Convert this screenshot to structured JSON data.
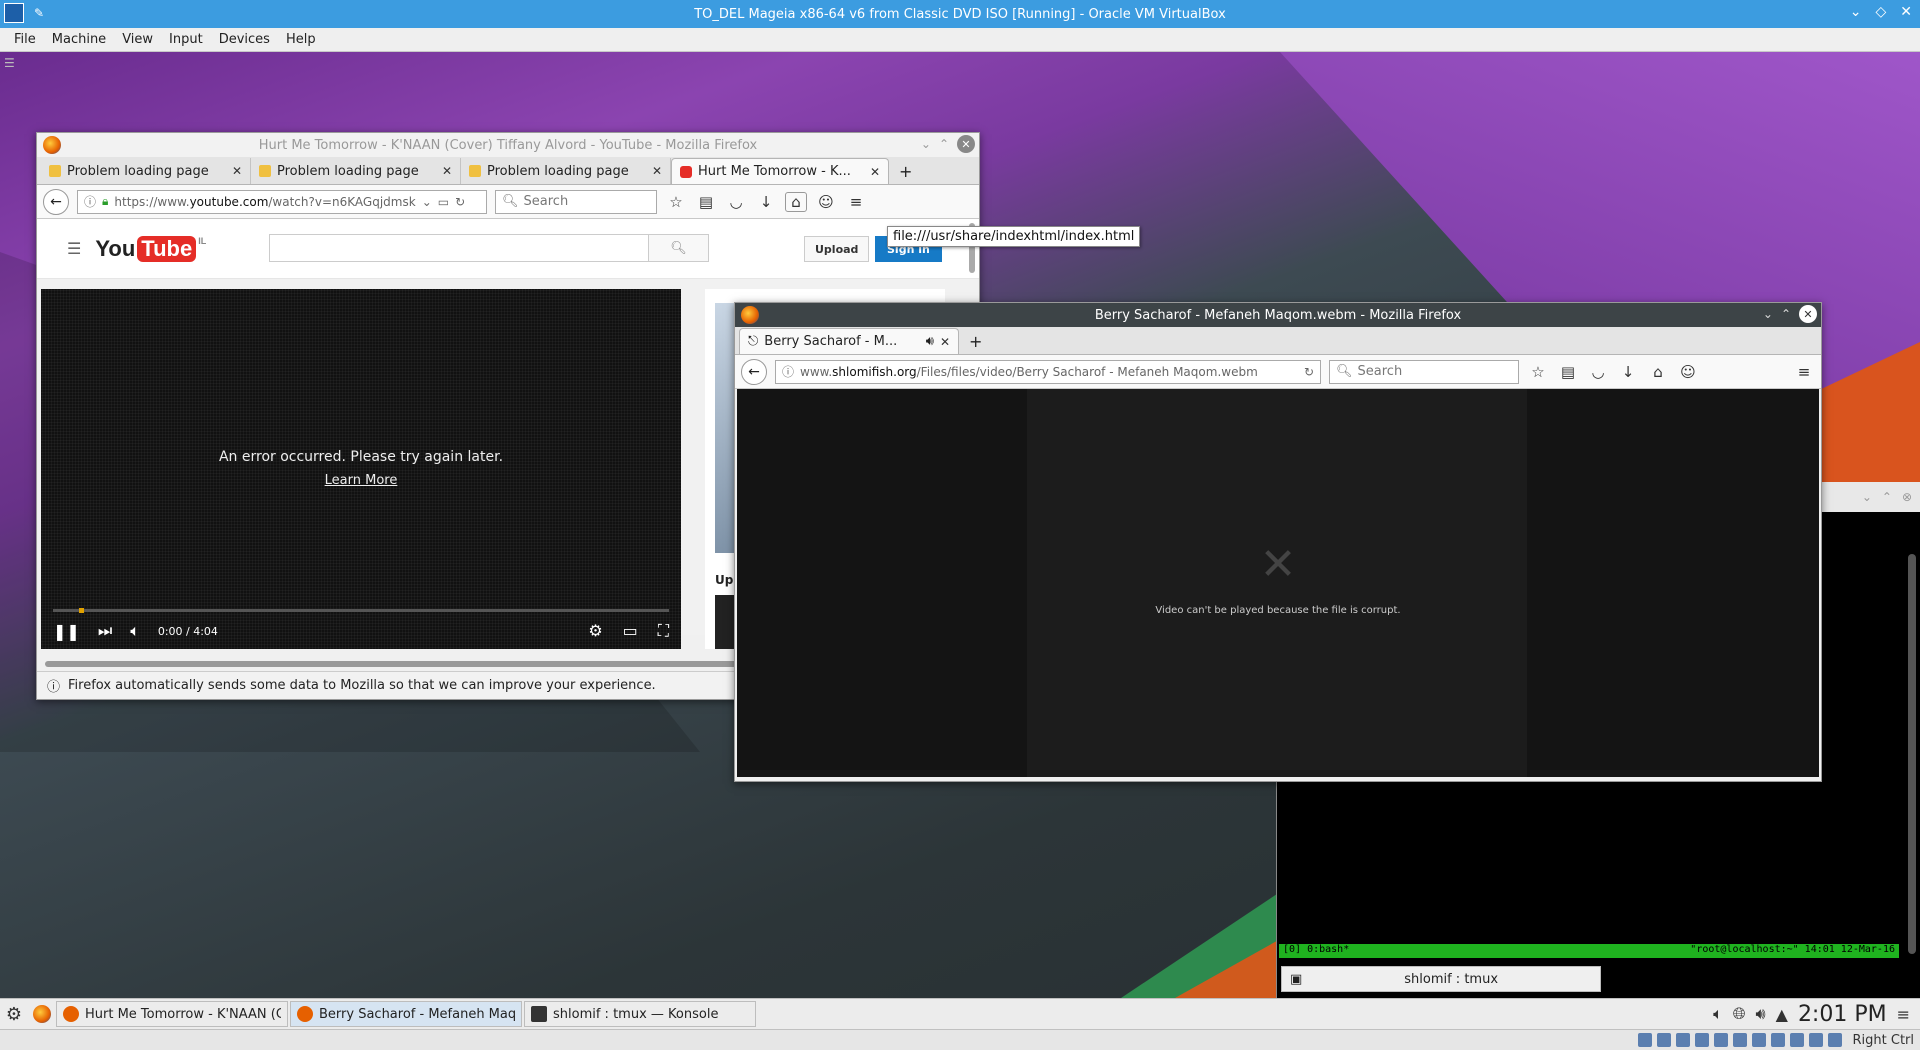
{
  "vbox": {
    "title": "TO_DEL Mageia x86-64 v6 from Classic DVD ISO [Running] - Oracle VM VirtualBox",
    "menu": [
      "File",
      "Machine",
      "View",
      "Input",
      "Devices",
      "Help"
    ],
    "host_key": "Right Ctrl"
  },
  "ff1": {
    "title": "Hurt Me Tomorrow - K'NAAN (Cover) Tiffany Alvord - YouTube - Mozilla Firefox",
    "tabs": [
      {
        "label": "Problem loading page",
        "icon": "warning-icon"
      },
      {
        "label": "Problem loading page",
        "icon": "warning-icon"
      },
      {
        "label": "Problem loading page",
        "icon": "warning-icon"
      },
      {
        "label": "Hurt Me Tomorrow - K...",
        "icon": "youtube-icon"
      }
    ],
    "url_prefix": "https://www.",
    "url_domain": "youtube.com",
    "url_rest": "/watch?v=n6KAGqjdmsk",
    "search_placeholder": "Search",
    "home_tooltip": "file:///usr/share/indexhtml/index.html",
    "yt": {
      "logo_you": "You",
      "logo_tube": "Tube",
      "logo_country": "IL",
      "upload": "Upload",
      "signin": "Sign in",
      "error": "An error occurred. Please try again later.",
      "learn_more": "Learn More",
      "time": "0:00 / 4:04",
      "up_next": "Up ne"
    },
    "notice": "Firefox automatically sends some data to Mozilla so that we can improve your experience."
  },
  "ff2": {
    "title": "Berry Sacharof - Mefaneh Maqom.webm - Mozilla Firefox",
    "tab": "Berry Sacharof - M...",
    "url_prefix": "www.",
    "url_domain": "shlomifish.org",
    "url_rest": "/Files/files/video/Berry Sacharof - Mefaneh Maqom.webm",
    "search_placeholder": "Search",
    "video_error": "Video can't be played because the file is corrupt."
  },
  "konsole": {
    "tmux_left": "[0] 0:bash*",
    "tmux_right": "\"root@localhost:~\" 14:01 12-Mar-16",
    "tab_label": "shlomif : tmux"
  },
  "taskbar": {
    "tasks": [
      {
        "label": "Hurt Me Tomorrow - K'NAAN (C",
        "icon_color": "#e66000"
      },
      {
        "label": "Berry Sacharof - Mefaneh Maq",
        "icon_color": "#e66000"
      },
      {
        "label": "shlomif : tmux — Konsole",
        "icon_color": "#333333"
      }
    ],
    "clock": "2:01 PM"
  }
}
